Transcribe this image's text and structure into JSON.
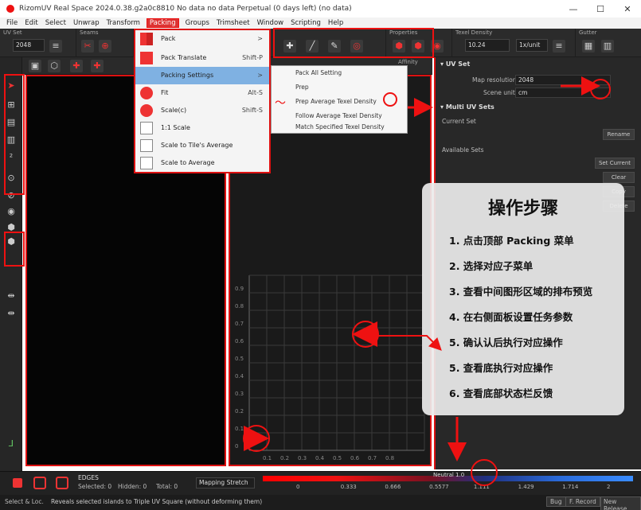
{
  "window": {
    "title": "RizomUV  Real Space 2024.0.38.g2a0c8810 No data no data Perpetual (0 days left) (no data)",
    "controls": [
      "—",
      "☐",
      "✕"
    ]
  },
  "menu": {
    "items": [
      "File",
      "Edit",
      "Select",
      "Unwrap",
      "Transform",
      "Packing",
      "Groups",
      "Trimsheet",
      "Window",
      "Scripting",
      "Help"
    ],
    "active": "Packing"
  },
  "toolbar": {
    "groups": [
      "UV Set",
      "Seams",
      "Properties",
      "Texel Density",
      "Gutter"
    ],
    "uvset_value": "2048",
    "texel_value": "10.24",
    "texel_unit": "1x/unit"
  },
  "packing_menu": {
    "items": [
      {
        "label": "Pack",
        "shortcut": ">"
      },
      {
        "label": "Pack Translate",
        "shortcut": "Shift-P"
      },
      {
        "label": "Packing Settings",
        "shortcut": ">"
      },
      {
        "label": "Fit",
        "shortcut": "Alt-S"
      },
      {
        "label": "Scale(c)",
        "shortcut": "Shift-S"
      },
      {
        "label": "1:1 Scale",
        "shortcut": ""
      },
      {
        "label": "Scale to Tile's Average",
        "shortcut": ""
      },
      {
        "label": "Scale to Average",
        "shortcut": ""
      }
    ]
  },
  "packing_submenu": {
    "items": [
      "Pack All Setting",
      "Prep",
      "Prep Average Texel Density",
      "Follow Average Texel Density",
      "Match Specified Texel Density"
    ]
  },
  "right_panel": {
    "uvset_header": "UV Set",
    "map_resolution_label": "Map resolution",
    "map_resolution_value": "2048",
    "scene_unit_label": "Scene unit",
    "scene_unit_value": "cm",
    "multi_header": "Multi UV Sets",
    "current_set_label": "Current Set",
    "available_sets_label": "Available Sets",
    "buttons": [
      "Rename",
      "Set Current",
      "Clear",
      "Copy",
      "Delete"
    ]
  },
  "viewport": {
    "tick_labels_y": [
      "0.9",
      "0.8",
      "0.7",
      "0.6",
      "0.5",
      "0.4",
      "0.3",
      "0.2",
      "0.1",
      "0"
    ],
    "tick_labels_x": [
      "0.1",
      "0.2",
      "0.3",
      "0.4",
      "0.5",
      "0.6",
      "0.7",
      "0.8"
    ],
    "header_label": "Affinity"
  },
  "bottom": {
    "edges_label": "EDGES",
    "selected": "Selected: 0",
    "hidden": "Hidden: 0",
    "total": "Total: 0",
    "mode_select": "Mapping Stretch",
    "scale_labels": [
      "0",
      "0.333",
      "0.666",
      "0.5577",
      "1.111",
      "1.429",
      "1.714",
      "2"
    ],
    "scale_marker": "Neutral 1.0"
  },
  "status": {
    "left": "Select & Loc.",
    "message": "Reveals selected islands to Triple UV Square (without deforming them)",
    "buttons": [
      "Bug",
      "F. Record",
      "New Release"
    ]
  },
  "steps": {
    "title": "操作步骤",
    "items": [
      "1. 点击顶部 Packing 菜单",
      "2. 选择对应子菜单",
      "3. 查看中间图形区域的排布预览",
      "4. 在右侧面板设置任务参数",
      "5. 确认认后执行对应操作",
      "5. 查看底执行对应操作",
      "6. 查看底部状态栏反馈"
    ]
  },
  "colors": {
    "accent": "#dd1111",
    "menu_highlight": "#7fb1e2",
    "panel_bg": "#282828"
  }
}
